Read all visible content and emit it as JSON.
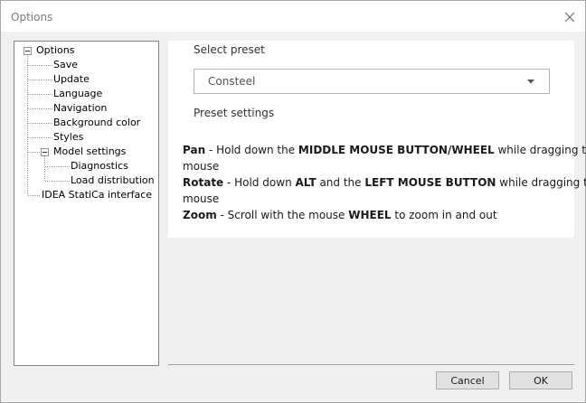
{
  "window": {
    "title": "Options"
  },
  "tree": {
    "root": "Options",
    "items": [
      "Save",
      "Update",
      "Language",
      "Navigation",
      "Background color",
      "Styles"
    ],
    "model_settings": {
      "label": "Model settings",
      "children": [
        "Diagnostics",
        "Load distribution"
      ]
    },
    "last": "IDEA StatiCa interface"
  },
  "panel": {
    "select_preset_label": "Select preset",
    "preset_value": "Consteel",
    "preset_settings_label": "Preset settings",
    "help": {
      "pan": {
        "key": "Pan",
        "t1": " - Hold down the ",
        "b1": "MIDDLE MOUSE BUTTON/WHEEL",
        "t2": " while dragging the",
        "cont": "mouse"
      },
      "rotate": {
        "key": "Rotate",
        "t1": " - Hold down ",
        "b1": "ALT",
        "t2": " and the ",
        "b2": "LEFT MOUSE BUTTON",
        "t3": " while dragging the",
        "cont": "mouse"
      },
      "zoom": {
        "key": "Zoom",
        "t1": " - Scroll with the mouse ",
        "b1": "WHEEL",
        "t2": " to zoom in and out"
      }
    }
  },
  "buttons": {
    "cancel": "Cancel",
    "ok": "OK"
  }
}
